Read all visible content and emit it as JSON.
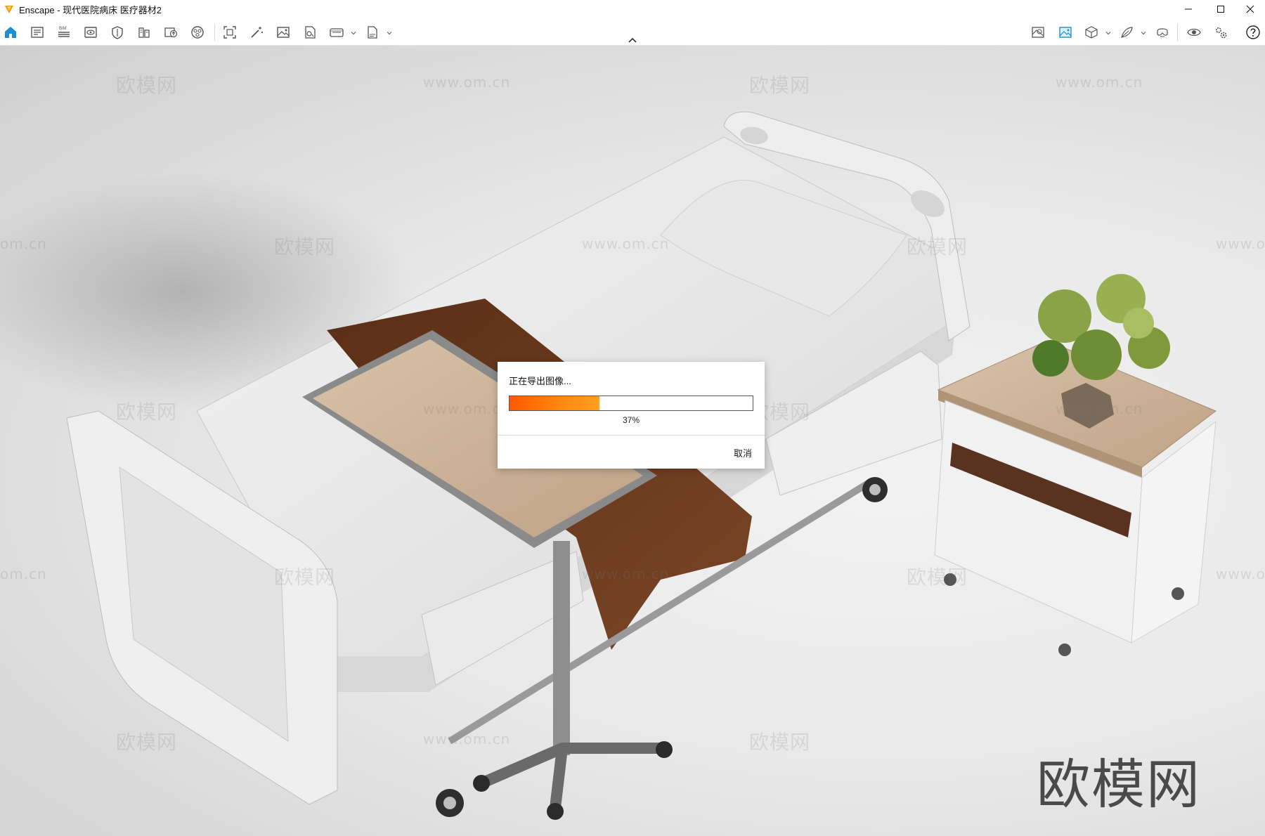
{
  "window": {
    "title": "Enscape - 现代医院病床 医疗器材2",
    "controls": [
      "minimize-icon",
      "maximize-icon",
      "close-icon"
    ]
  },
  "toolbar": {
    "accent_color": "#1a8fd6",
    "left_icons": [
      "home-icon",
      "capture-list-icon",
      "bim-icon",
      "view-icon",
      "material-icon",
      "asset-library-icon",
      "upload-icon",
      "atmosphere-icon",
      "screenshot-icon",
      "wand-icon",
      "image-icon",
      "batch-render-icon",
      "panorama-icon",
      "export-file-icon"
    ],
    "bim_label": "BIM",
    "right_icons": [
      "minimap-icon",
      "image-view-icon",
      "cube-icon",
      "feather-icon",
      "vr-headset-icon",
      "eye-icon",
      "settings-icon",
      "help-icon"
    ]
  },
  "watermarks": {
    "brand": "欧模网",
    "url": "www.om.cn",
    "url_fragment": "om.cn",
    "big_logo": "欧模网"
  },
  "dialog": {
    "title": "正在导出图像...",
    "progress": 0.37,
    "progress_text": "37%",
    "cancel_label": "取消",
    "progress_colors": [
      "#ff5a00",
      "#ffa020"
    ]
  },
  "scene_colors": {
    "blanket": "#6b3a1f",
    "wood": "#cdb49a",
    "bed_white": "#efefef",
    "foliage": "#8aa346"
  }
}
